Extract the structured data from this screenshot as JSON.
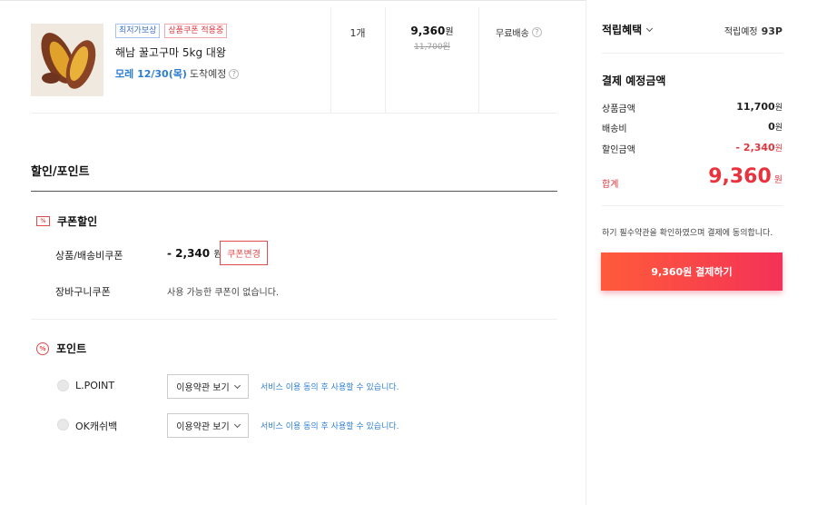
{
  "product": {
    "badges": [
      "최저가보상",
      "상품쿠폰 적용중"
    ],
    "name": "해남 꿀고구마 5kg 대왕",
    "arrival_date": "모레 12/30(목)",
    "arrival_suffix": "도착예정",
    "help_symbol": "?",
    "quantity": "1개",
    "price_number": "9,360",
    "price_unit": "원",
    "original_price": "11,700원",
    "shipping": "무료배송"
  },
  "discount": {
    "title": "할인/포인트",
    "coupon_section": {
      "icon_text": "%",
      "label": "쿠폰할인",
      "product_coupon_label": "상품/배송비쿠폰",
      "product_coupon_number": "- 2,340",
      "product_coupon_unit": "원",
      "change_button": "쿠폰변경",
      "cart_coupon_label": "장바구니쿠폰",
      "cart_coupon_value": "사용 가능한 쿠폰이 없습니다."
    },
    "point_section": {
      "icon_text": "%",
      "label": "포인트",
      "items": [
        {
          "name": "L.POINT",
          "select_label": "이용약관 보기",
          "note": "서비스 이용 동의 후 사용할 수 있습니다."
        },
        {
          "name": "OK캐쉬백",
          "select_label": "이용약관 보기",
          "note": "서비스 이용 동의 후 사용할 수 있습니다."
        }
      ]
    }
  },
  "sidebar": {
    "reward_title": "적립혜택",
    "reward_label": "적립예정",
    "reward_value": "93P",
    "payment_title": "결제 예정금액",
    "rows": [
      {
        "label": "상품금액",
        "number": "11,700",
        "unit": "원"
      },
      {
        "label": "배송비",
        "number": "0",
        "unit": "원"
      },
      {
        "label": "할인금액",
        "number": "- 2,340",
        "unit": "원"
      }
    ],
    "total_label": "합계",
    "total_number": "9,360",
    "total_unit": "원",
    "terms_note": "하기 필수약관을 확인하였으며 결제에 동의합니다.",
    "pay_button": "9,360원 결제하기"
  },
  "colors": {
    "accent_red": "#e8333f",
    "link_blue": "#2f7fd1",
    "pay_gradient_start": "#ff5b3a",
    "pay_gradient_end": "#f43257"
  }
}
